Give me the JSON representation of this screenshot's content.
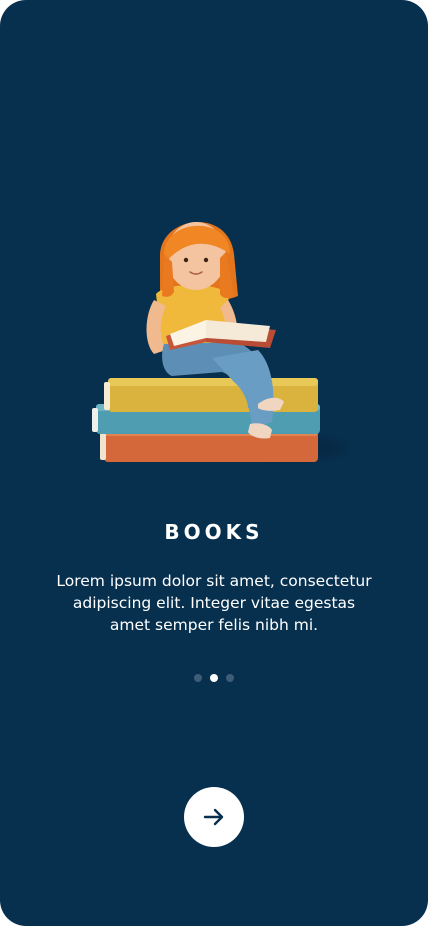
{
  "onboarding": {
    "illustration": "girl-reading-on-books-illustration",
    "title": "BOOKS",
    "description": "Lorem ipsum dolor sit amet, consectetur adipiscing elit. Integer vitae egestas amet semper felis nibh mi.",
    "pagination": {
      "total": 3,
      "active_index": 1
    },
    "next_button": {
      "icon": "arrow-right-icon"
    }
  },
  "colors": {
    "background": "#07304f",
    "text": "#ffffff",
    "dot_inactive": "#3e5d78",
    "dot_active": "#ffffff",
    "button_bg": "#ffffff",
    "button_icon": "#07304f"
  }
}
